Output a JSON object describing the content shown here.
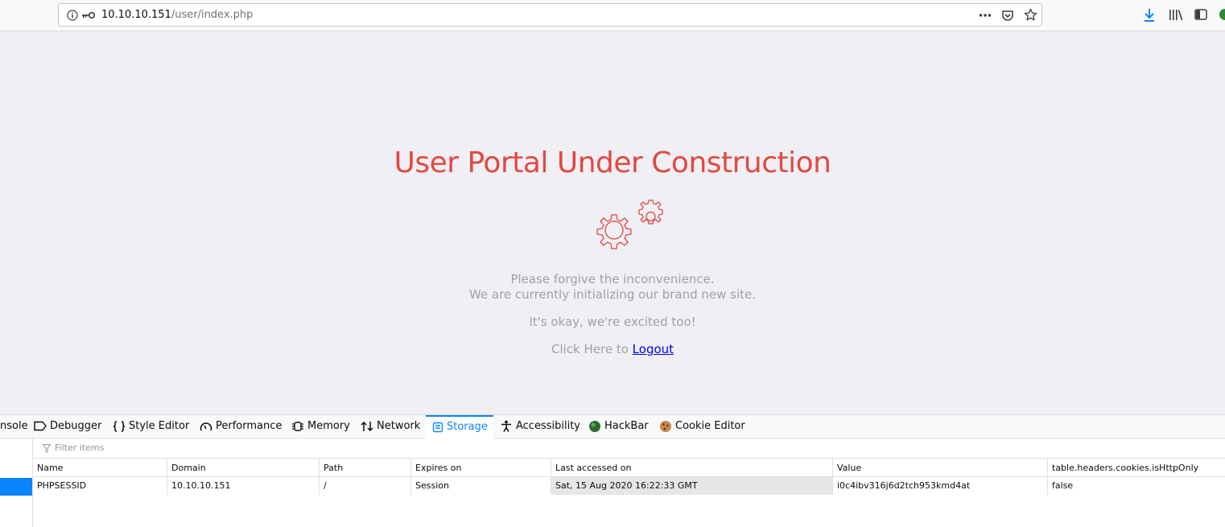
{
  "browser": {
    "url_host": "10.10.10.151",
    "url_path": "/user/index.php"
  },
  "page": {
    "headline": "User Portal Under Construction",
    "line1": "Please forgive the inconvenience.",
    "line2": "We are currently initializing our brand new site.",
    "line3": "It's okay, we're excited too!",
    "logout_prefix": "Click Here to",
    "logout_link": "Logout",
    "accent_color": "#e24840"
  },
  "devtools": {
    "tabs": [
      {
        "label": "nsole"
      },
      {
        "label": "Debugger"
      },
      {
        "label": "Style Editor"
      },
      {
        "label": "Performance"
      },
      {
        "label": "Memory"
      },
      {
        "label": "Network"
      },
      {
        "label": "Storage",
        "active": true
      },
      {
        "label": "Accessibility"
      },
      {
        "label": "HackBar"
      },
      {
        "label": "Cookie Editor"
      }
    ],
    "filter_placeholder": "Filter items",
    "columns": [
      "Name",
      "Domain",
      "Path",
      "Expires on",
      "Last accessed on",
      "Value",
      "table.headers.cookies.isHttpOnly"
    ],
    "rows": [
      {
        "name": "PHPSESSID",
        "domain": "10.10.10.151",
        "path": "/",
        "expires": "Session",
        "last_accessed": "Sat, 15 Aug 2020 16:22:33 GMT",
        "value": "i0c4ibv316j6d2tch953kmd4at",
        "http_only": "false"
      }
    ]
  }
}
